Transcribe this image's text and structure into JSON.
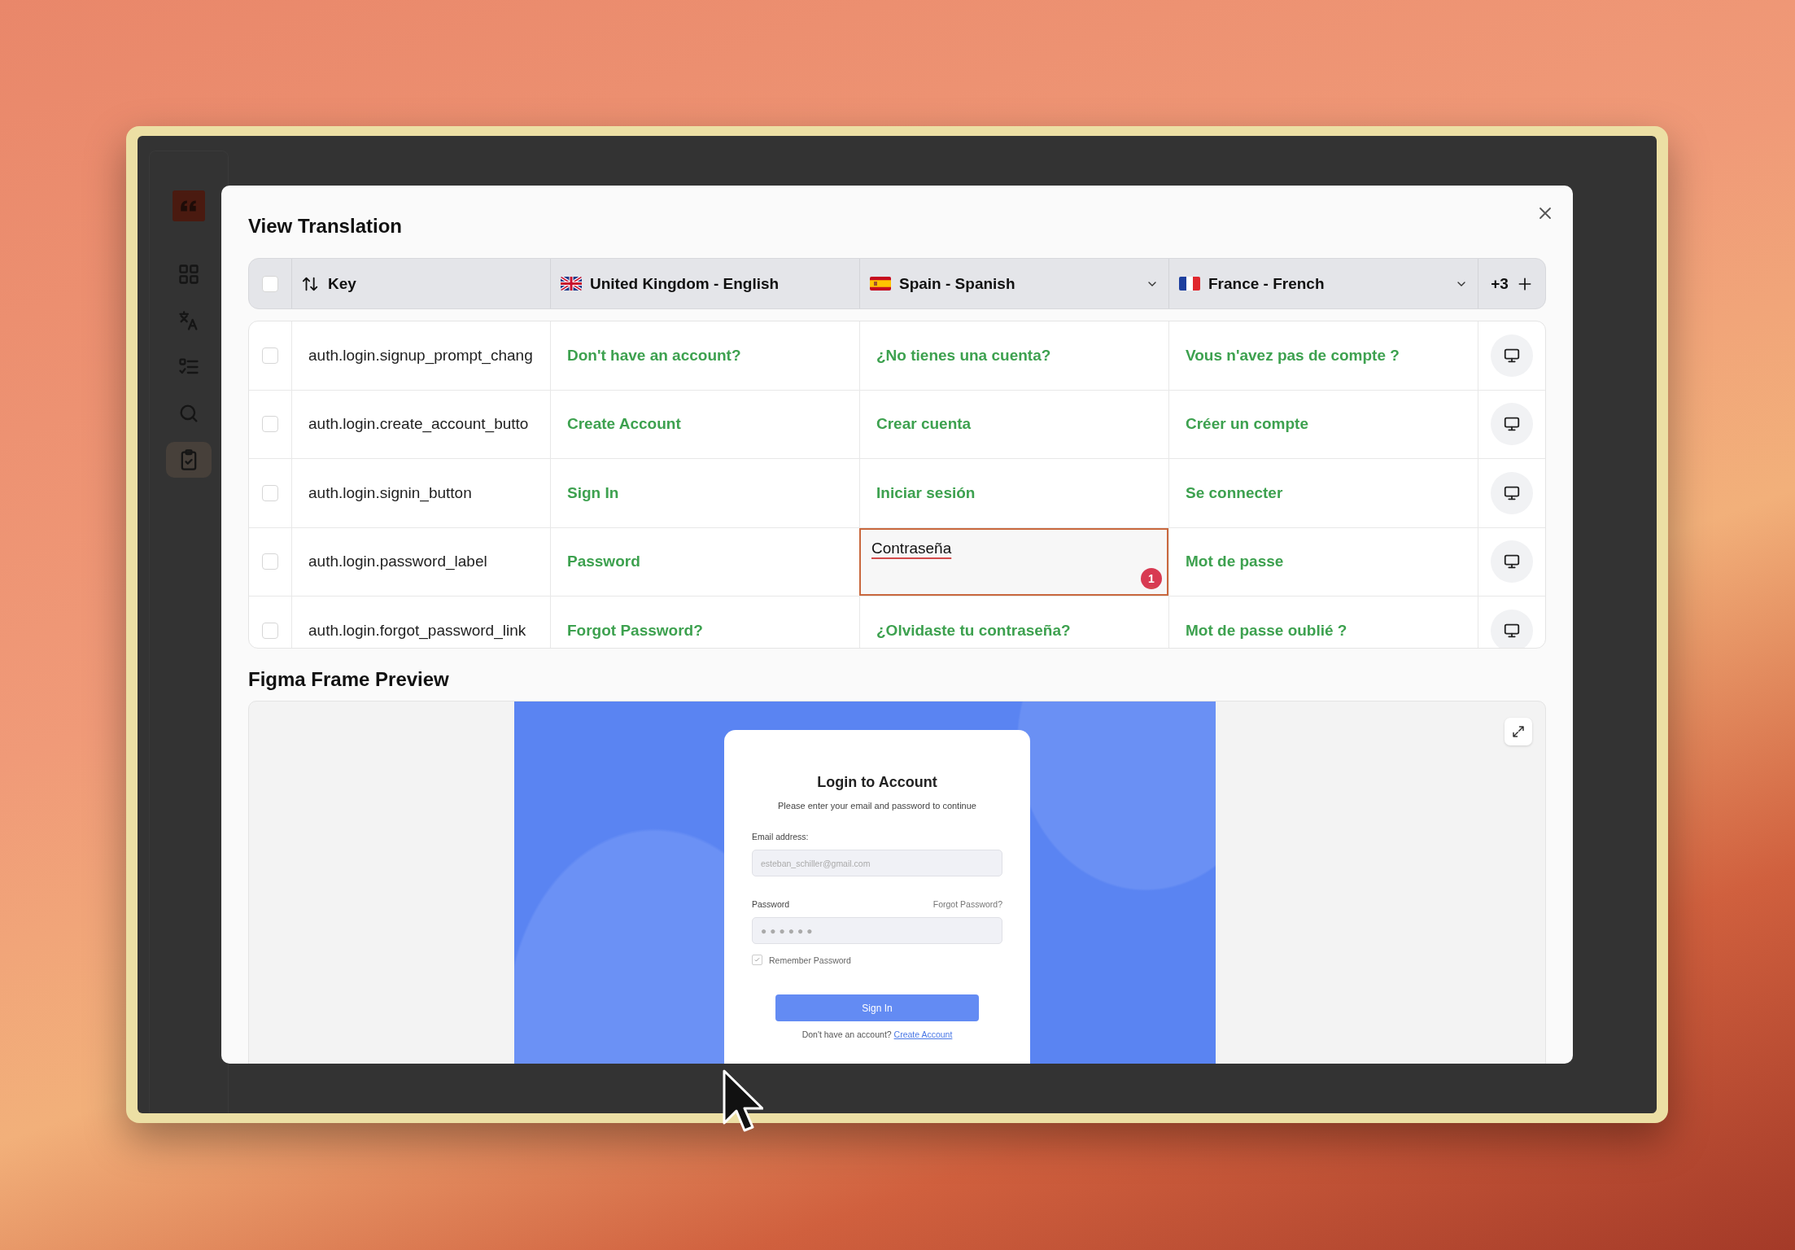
{
  "sidebar": {
    "items": [
      {
        "kind": "grid",
        "selected": false
      },
      {
        "kind": "translate",
        "selected": false
      },
      {
        "kind": "checklist",
        "selected": false
      },
      {
        "kind": "search",
        "selected": false
      },
      {
        "kind": "clipboard",
        "selected": true
      }
    ]
  },
  "window": {
    "title": "View Translation"
  },
  "table": {
    "header": {
      "select_all": {
        "checked": false
      },
      "key_column": "Key",
      "languages": [
        {
          "label": "United Kingdom - English",
          "kind": "uk",
          "dropdown": false
        },
        {
          "label": "Spain - Spanish",
          "kind": "es",
          "dropdown": true
        },
        {
          "label": "France - French",
          "kind": "fr",
          "dropdown": true
        }
      ],
      "more_languages": "+3"
    },
    "rows": [
      {
        "checked": false,
        "key": "auth.login.signup_prompt_chang",
        "translations": [
          {
            "text": "Don't have an account?",
            "editing": false
          },
          {
            "text": "¿No tienes una cuenta?",
            "editing": false
          },
          {
            "text": "Vous n'avez pas de compte ?",
            "editing": false
          }
        ]
      },
      {
        "checked": false,
        "key": "auth.login.create_account_butto",
        "translations": [
          {
            "text": "Create Account",
            "editing": false
          },
          {
            "text": "Crear cuenta",
            "editing": false
          },
          {
            "text": "Créer un compte",
            "editing": false
          }
        ]
      },
      {
        "checked": false,
        "key": "auth.login.signin_button",
        "translations": [
          {
            "text": "Sign In",
            "editing": false
          },
          {
            "text": "Iniciar sesión",
            "editing": false
          },
          {
            "text": "Se connecter",
            "editing": false
          }
        ]
      },
      {
        "checked": false,
        "key": "auth.login.password_label",
        "translations": [
          {
            "text": "Password",
            "editing": false
          },
          {
            "text": "Contraseña",
            "editing": true,
            "issues": "1"
          },
          {
            "text": "Mot de passe",
            "editing": false
          }
        ]
      },
      {
        "checked": false,
        "key": "auth.login.forgot_password_link",
        "translations": [
          {
            "text": "Forgot Password?",
            "editing": false
          },
          {
            "text": "¿Olvidaste tu contraseña?",
            "editing": false
          },
          {
            "text": "Mot de passe oublié ?",
            "editing": false
          }
        ]
      }
    ]
  },
  "preview": {
    "title": "Figma Frame Preview",
    "frame": {
      "heading": "Login to Account",
      "subheading": "Please enter your email and password to continue",
      "email_label": "Email address:",
      "email_placeholder": "esteban_schiller@gmail.com",
      "password_label": "Password",
      "forgot_link": "Forgot Password?",
      "password_value": "●●●●●●",
      "remember": {
        "label": "Remember Password",
        "checked": true
      },
      "button": "Sign In",
      "footer_text": "Don't have an account?",
      "footer_link": "Create Account"
    }
  }
}
